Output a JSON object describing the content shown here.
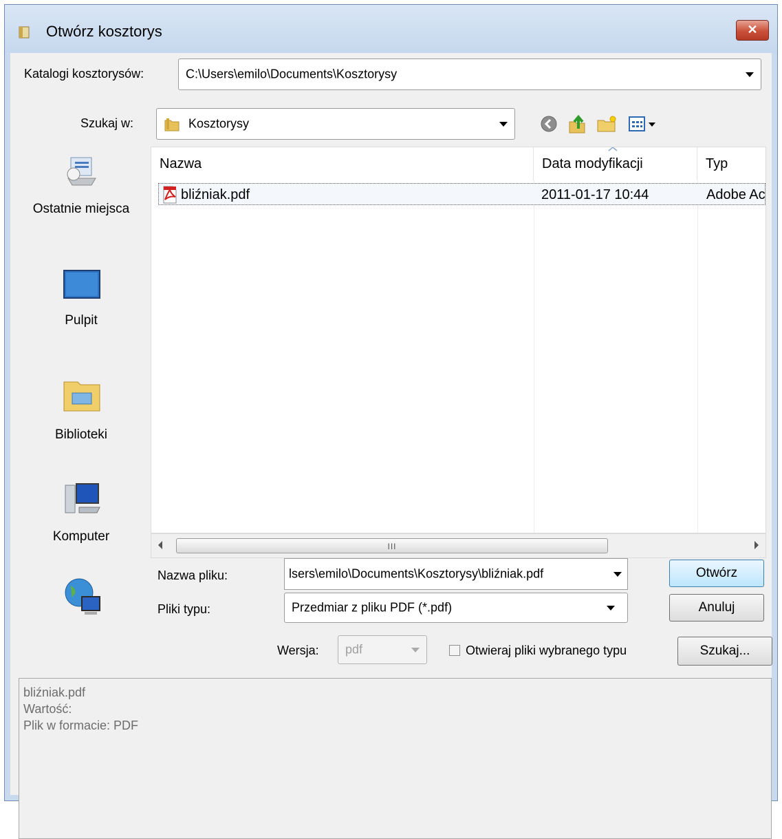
{
  "window": {
    "title": "Otwórz kosztorys",
    "close_label": "✕"
  },
  "catalog": {
    "label": "Katalogi kosztorysów:",
    "value": "C:\\Users\\emilo\\Documents\\Kosztorysy"
  },
  "lookin": {
    "label": "Szukaj w:",
    "value": "Kosztorysy",
    "icons": [
      "back-icon",
      "up-folder-icon",
      "new-folder-icon",
      "view-menu-icon"
    ]
  },
  "sidebar": {
    "items": [
      {
        "label": "Ostatnie miejsca",
        "icon": "recent-places-icon"
      },
      {
        "label": "Pulpit",
        "icon": "desktop-icon"
      },
      {
        "label": "Biblioteki",
        "icon": "libraries-icon"
      },
      {
        "label": "Komputer",
        "icon": "computer-icon"
      },
      {
        "label": "",
        "icon": "network-icon"
      }
    ]
  },
  "filelist": {
    "columns": [
      "Nazwa",
      "Data modyfikacji",
      "Typ"
    ],
    "rows": [
      {
        "name": "bliźniak.pdf",
        "date": "2011-01-17 10:44",
        "type": "Adobe Ac",
        "icon": "pdf-icon"
      }
    ],
    "scroll_grip": "III"
  },
  "filename": {
    "label": "Nazwa pliku:",
    "value": "lsers\\emilo\\Documents\\Kosztorysy\\bliźniak.pdf"
  },
  "filetype": {
    "label": "Pliki typu:",
    "value": "Przedmiar z pliku PDF (*.pdf)"
  },
  "buttons": {
    "open": "Otwórz",
    "cancel": "Anuluj",
    "search": "Szukaj..."
  },
  "version": {
    "label": "Wersja:",
    "value": "pdf"
  },
  "checkbox": {
    "label": "Otwieraj pliki wybranego typu",
    "checked": false
  },
  "info": {
    "line1": "bliźniak.pdf",
    "line2": "Wartość:",
    "line3": "Plik w formacie: PDF"
  }
}
